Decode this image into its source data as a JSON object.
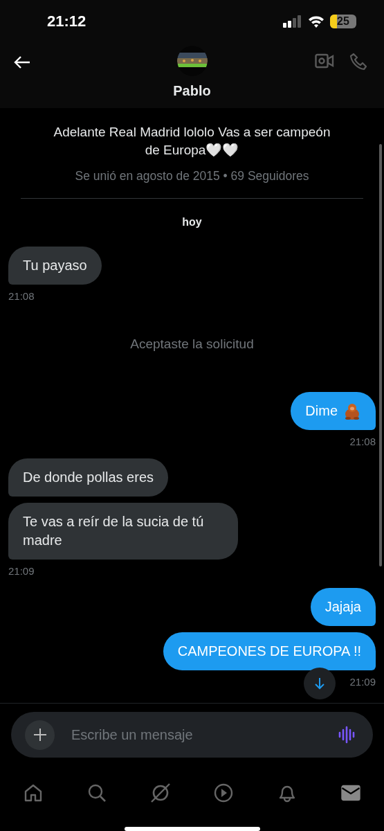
{
  "status_bar": {
    "time": "21:12",
    "battery": "25"
  },
  "header": {
    "name": "Pablo"
  },
  "profile": {
    "bio": "Adelante Real Madrid lololo Vas a ser campeón de Europa🤍🤍",
    "meta": "Se unió en agosto de 2015 • 69 Seguidores"
  },
  "date_label": "hoy",
  "messages": [
    {
      "kind": "received",
      "text": "Tu payaso",
      "time": "21:08"
    },
    {
      "kind": "notice",
      "text": "Aceptaste la solicitud"
    },
    {
      "kind": "sent",
      "text": "Dime",
      "trailing_icon": true,
      "time": "21:08"
    },
    {
      "kind": "received",
      "text": "De donde pollas eres"
    },
    {
      "kind": "received",
      "text": "Te vas a reír de la sucia de tú madre",
      "time": "21:09"
    },
    {
      "kind": "sent",
      "text": "Jajaja"
    },
    {
      "kind": "sent",
      "text": "CAMPEONES DE EUROPA !!",
      "time": "21:09"
    }
  ],
  "composer": {
    "placeholder": "Escribe un mensaje"
  },
  "tab_bar": [
    {
      "kind": "home",
      "selected": false
    },
    {
      "kind": "search",
      "selected": false
    },
    {
      "kind": "grok",
      "selected": false
    },
    {
      "kind": "video",
      "selected": false
    },
    {
      "kind": "notifications",
      "selected": false
    },
    {
      "kind": "messages",
      "selected": true
    }
  ]
}
